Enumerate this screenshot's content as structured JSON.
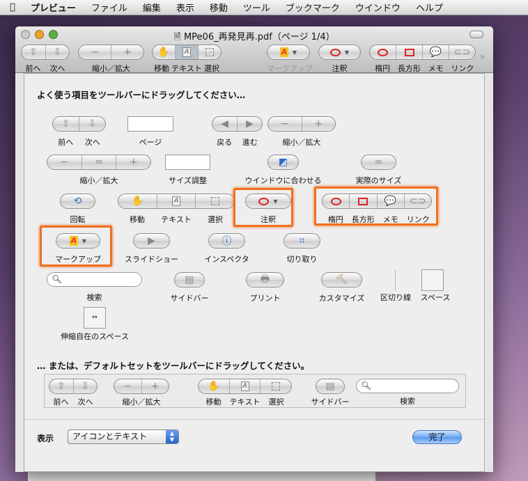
{
  "menubar": {
    "apple": "",
    "items": [
      "プレビュー",
      "ファイル",
      "編集",
      "表示",
      "移動",
      "ツール",
      "ブックマーク",
      "ウインドウ",
      "ヘルプ"
    ]
  },
  "window": {
    "title": "MPe06_再発見再.pdf（ページ 1/4）"
  },
  "toolbar": {
    "prev": "前へ",
    "next": "次へ",
    "zoom": "縮小／拡大",
    "move": "移動",
    "text": "テキスト",
    "select": "選択",
    "markup": "マークアップ",
    "annotate": "注釈",
    "oval": "楕円",
    "rect": "長方形",
    "note": "メモ",
    "link": "リンク",
    "overflow": "»"
  },
  "sheet": {
    "heading": "よく使う項目をツールバーにドラッグしてください…",
    "items": {
      "prev": "前へ",
      "next": "次へ",
      "page": "ページ",
      "back": "戻る",
      "forward": "進む",
      "zoom": "縮小／拡大",
      "zoom3": "縮小／拡大",
      "size": "サイズ調整",
      "fit": "ウインドウに合わせる",
      "actual": "実際のサイズ",
      "rotate": "回転",
      "move": "移動",
      "text": "テキスト",
      "select": "選択",
      "annotate": "注釈",
      "oval": "楕円",
      "rect": "長方形",
      "note": "メモ",
      "link": "リンク",
      "markup": "マークアップ",
      "slideshow": "スライドショー",
      "inspector": "インスペクタ",
      "crop": "切り取り",
      "search": "検索",
      "sidebar": "サイドバー",
      "print": "プリント",
      "customize": "カスタマイズ",
      "separator": "区切り線",
      "space": "スペース",
      "flexspace": "伸縮自在のスペース"
    },
    "default_heading": "… または、デフォルトセットをツールバーにドラッグしてください。",
    "default_items": {
      "prev": "前へ",
      "next": "次へ",
      "zoom": "縮小／拡大",
      "move": "移動",
      "text": "テキスト",
      "select": "選択",
      "sidebar": "サイドバー",
      "search": "検索"
    },
    "footer": {
      "show_label": "表示",
      "show_value": "アイコンとテキスト",
      "done": "完了"
    }
  },
  "colors": {
    "highlight": "#f07020",
    "annotation": "#dd2222",
    "accent": "#5a98ec"
  }
}
